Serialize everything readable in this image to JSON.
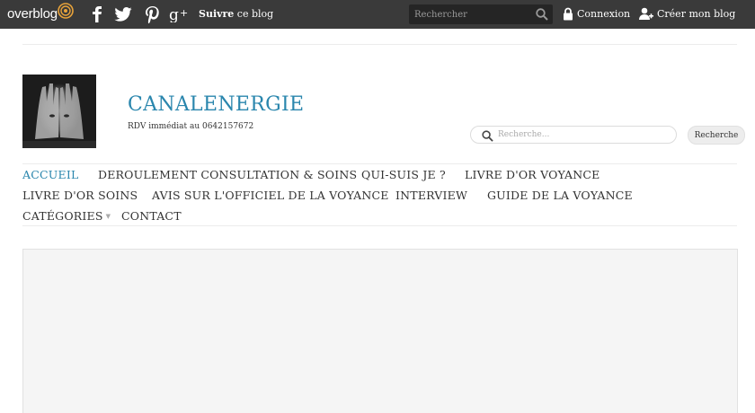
{
  "topbar": {
    "logo": "overblog",
    "follow_strong": "Suivre",
    "follow_rest": " ce blog",
    "search_placeholder": "Rechercher",
    "login": "Connexion",
    "create": "Créer mon blog",
    "social_icons": [
      "facebook-icon",
      "twitter-icon",
      "pinterest-icon",
      "google-plus-icon"
    ]
  },
  "header": {
    "title": "CANALENERGIE",
    "tagline": "RDV immédiat au 0642157672",
    "search_placeholder": "Recherche...",
    "search_button": "Recherche"
  },
  "nav": {
    "items": [
      {
        "label": "Accueil",
        "active": true
      },
      {
        "label": "Deroulement consultation & soins"
      },
      {
        "label": "Qui-suis je ?"
      },
      {
        "label": "Livre d'or voyance"
      },
      {
        "label": "Livre d'or soins"
      },
      {
        "label": "Avis sur l'officiel de la voyance"
      },
      {
        "label": "Interview"
      },
      {
        "label": "Guide de la voyance"
      },
      {
        "label": "Catégories",
        "has_dropdown": true
      },
      {
        "label": "Contact"
      }
    ]
  },
  "colors": {
    "topbar": "#3a3a3a",
    "accent": "#2a86ad",
    "text": "#333333"
  }
}
